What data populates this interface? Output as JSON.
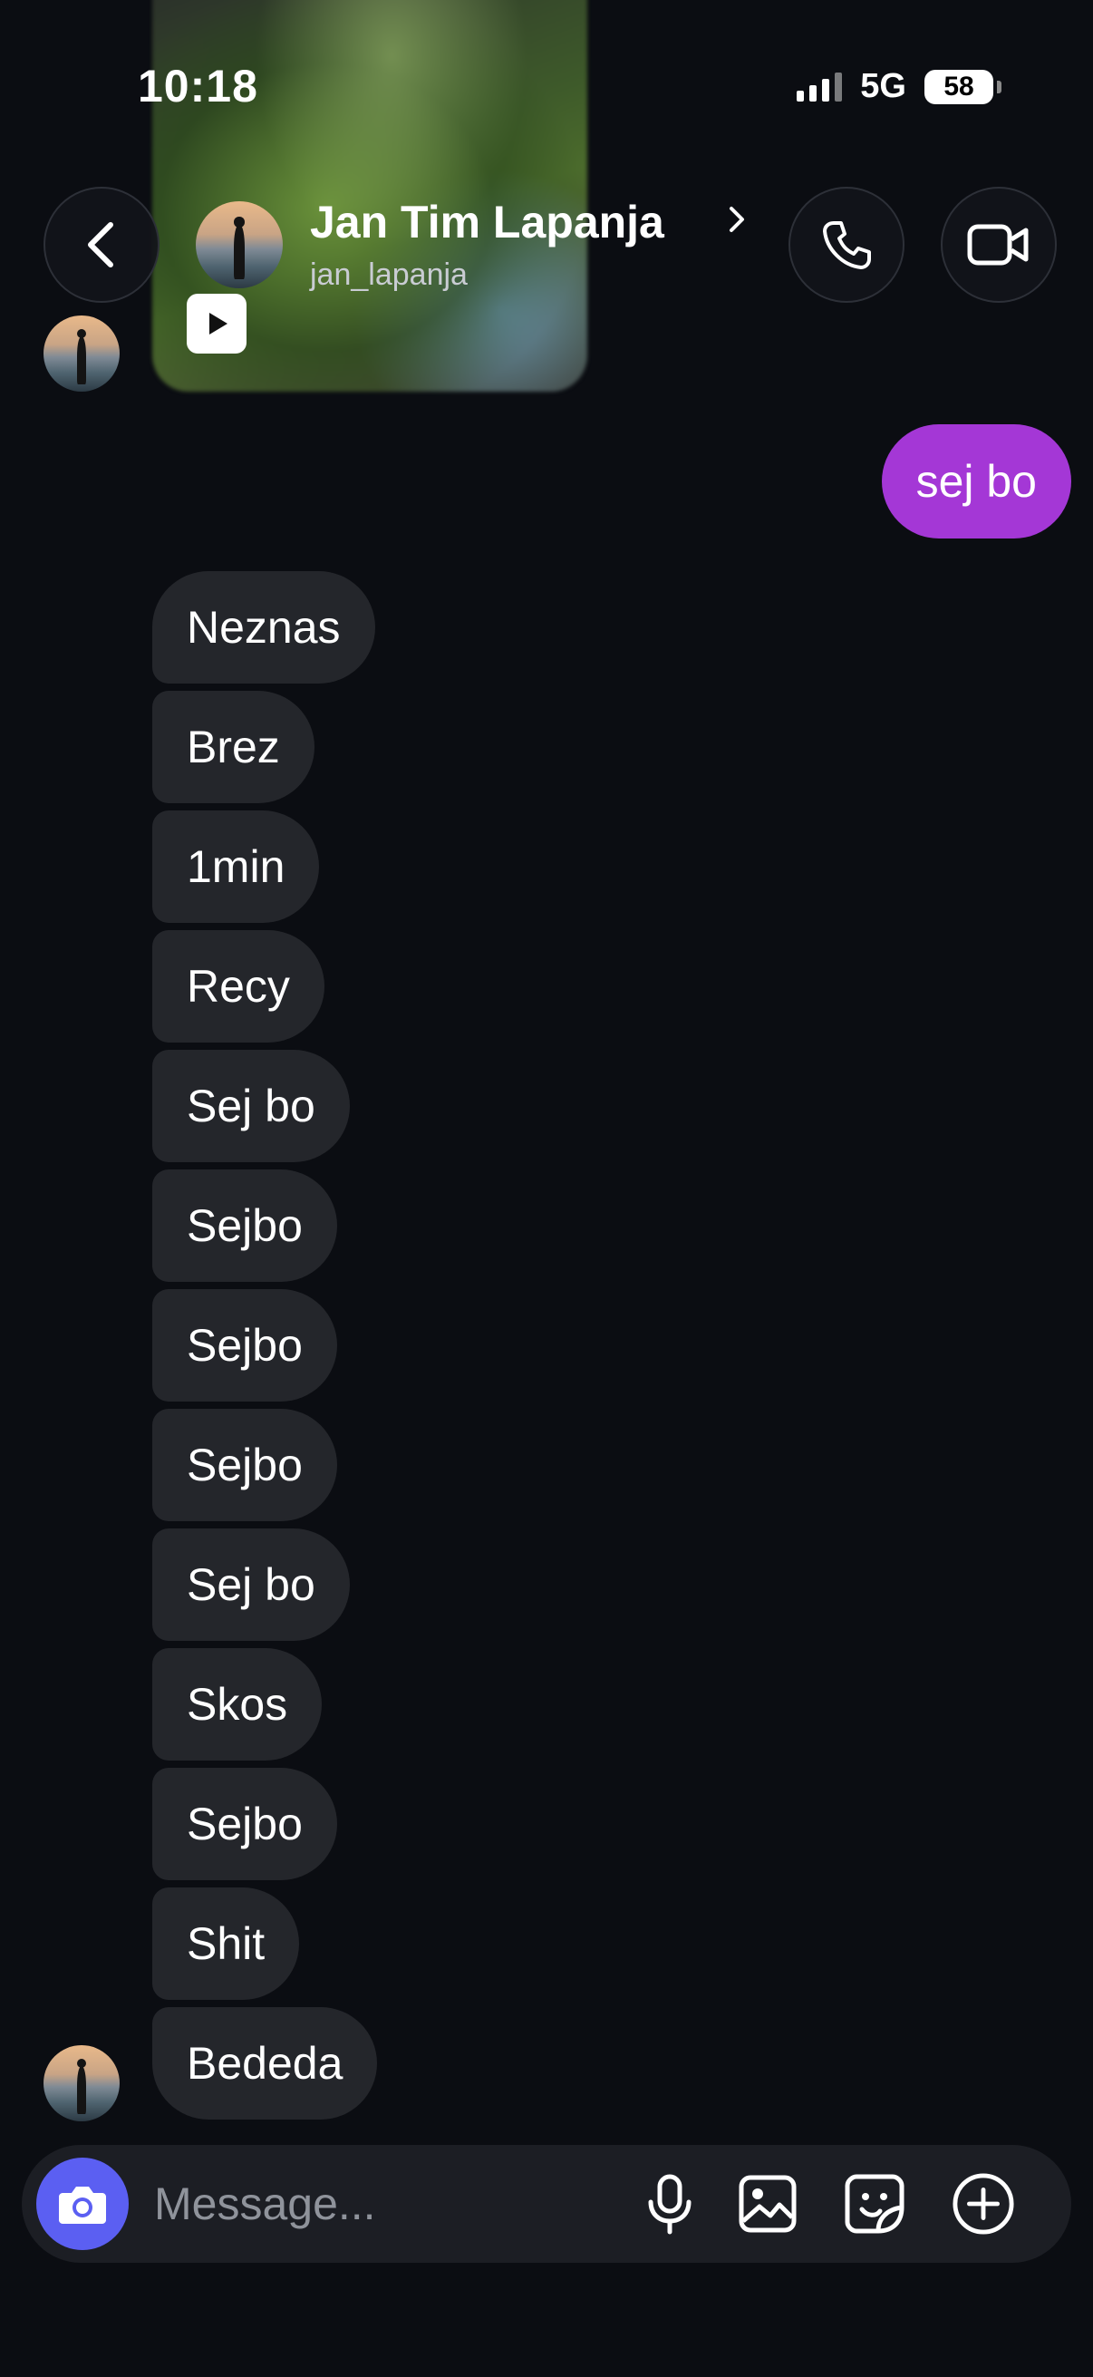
{
  "status_bar": {
    "time": "10:18",
    "network": "5G",
    "battery": "58"
  },
  "header": {
    "contact_name": "Jan Tim Lapanja",
    "contact_handle": "jan_lapanja",
    "icons": {
      "back": "chevron-left-icon",
      "call": "phone-icon",
      "video": "video-camera-icon"
    }
  },
  "shared_reel": {
    "icon": "play-icon"
  },
  "messages": {
    "outgoing": [
      {
        "text": "sej bo"
      }
    ],
    "incoming": [
      {
        "text": "Neznas"
      },
      {
        "text": "Brez"
      },
      {
        "text": "1min"
      },
      {
        "text": "Recy"
      },
      {
        "text": "Sej bo"
      },
      {
        "text": "Sejbo"
      },
      {
        "text": "Sejbo"
      },
      {
        "text": "Sejbo"
      },
      {
        "text": "Sej bo"
      },
      {
        "text": "Skos"
      },
      {
        "text": "Sejbo"
      },
      {
        "text": "Shit"
      },
      {
        "text": "Bededa"
      }
    ]
  },
  "composer": {
    "placeholder": "Message...",
    "value": "",
    "icons": [
      "camera-icon",
      "microphone-icon",
      "gallery-icon",
      "sticker-icon",
      "plus-circle-icon"
    ]
  },
  "colors": {
    "background": "#0b0d12",
    "incoming_bubble": "#24262b",
    "outgoing_bubble": "#a437d6",
    "camera_button": "#5b5ff2"
  }
}
